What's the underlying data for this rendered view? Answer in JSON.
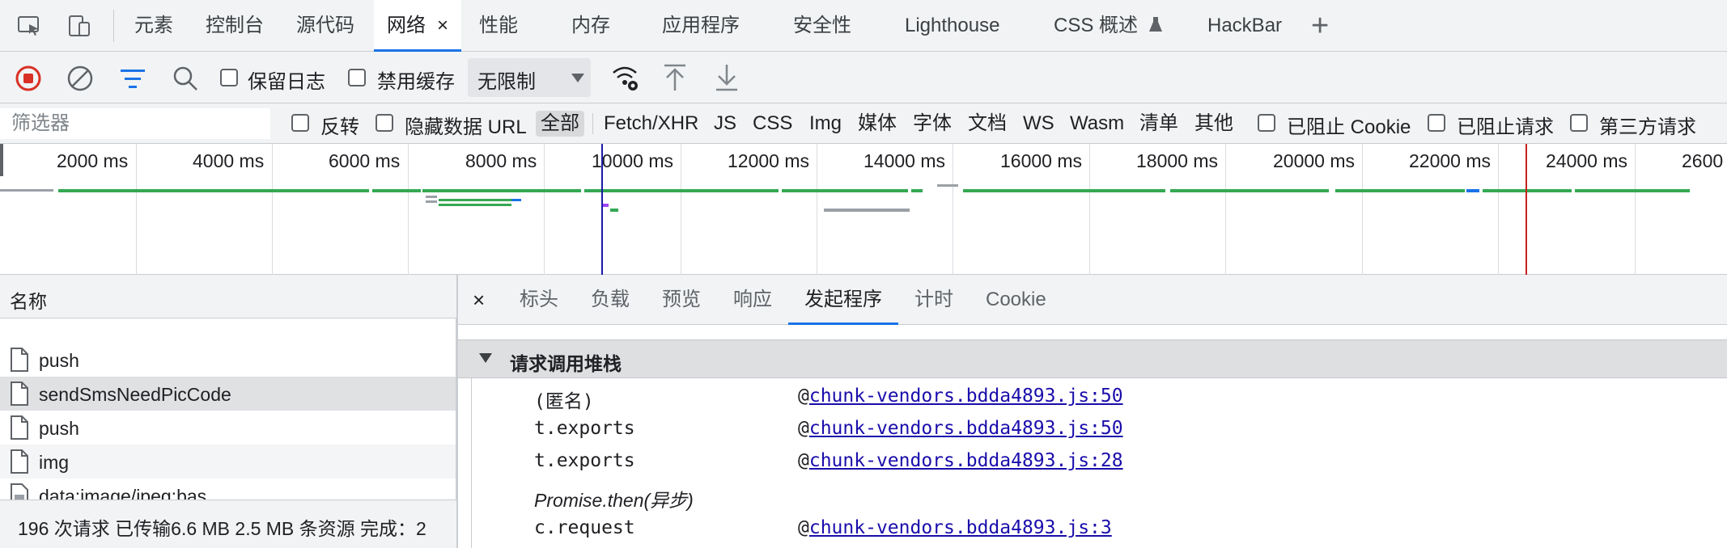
{
  "tabs": {
    "items": [
      "元素",
      "控制台",
      "源代码",
      "网络",
      "性能",
      "内存",
      "应用程序",
      "安全性",
      "Lighthouse",
      "CSS 概述",
      "HackBar"
    ],
    "active_close": "×",
    "add": "+"
  },
  "toolbar": {
    "preserve_log": "保留日志",
    "disable_cache": "禁用缓存",
    "throttling": "无限制"
  },
  "filter": {
    "placeholder": "筛选器",
    "invert": "反转",
    "hide_data_urls": "隐藏数据 URL",
    "types": [
      "全部",
      "Fetch/XHR",
      "JS",
      "CSS",
      "Img",
      "媒体",
      "字体",
      "文档",
      "WS",
      "Wasm",
      "清单",
      "其他"
    ],
    "blocked_cookies": "已阻止 Cookie",
    "blocked_requests": "已阻止请求",
    "third_party": "第三方请求"
  },
  "timeline": {
    "ticks": [
      "2000 ms",
      "4000 ms",
      "6000 ms",
      "8000 ms",
      "10000 ms",
      "12000 ms",
      "14000 ms",
      "16000 ms",
      "18000 ms",
      "20000 ms",
      "22000 ms",
      "24000 ms",
      "2600"
    ]
  },
  "request_list": {
    "header": "名称",
    "rows": [
      "push",
      "sendSmsNeedPicCode",
      "push",
      "img",
      "data:image/jpeg;bas…"
    ],
    "selected": "sendSmsNeedPicCode",
    "status": "196 次请求  已传输6.6 MB  2.5 MB 条资源  完成：2"
  },
  "details": {
    "close": "×",
    "tabs": [
      "标头",
      "负载",
      "预览",
      "响应",
      "发起程序",
      "计时",
      "Cookie"
    ],
    "active_tab": "发起程序",
    "section_title": "请求调用堆栈",
    "frames": [
      {
        "fn": "(匿名)",
        "at": "@",
        "link": "chunk-vendors.bdda4893.js:50"
      },
      {
        "fn": "t.exports",
        "at": "@",
        "link": "chunk-vendors.bdda4893.js:50"
      },
      {
        "fn": "t.exports",
        "at": "@",
        "link": "chunk-vendors.bdda4893.js:28"
      },
      {
        "fn": "Promise.then(异步)",
        "at": "",
        "link": ""
      },
      {
        "fn": "c.request",
        "at": "@",
        "link": "chunk-vendors.bdda4893.js:3"
      }
    ]
  },
  "colors": {
    "accent": "#1a73e8",
    "record": "#d93025",
    "timeline_green": "#34a853",
    "dom_line": "#1a1aa6",
    "load_line": "#c5221f"
  }
}
